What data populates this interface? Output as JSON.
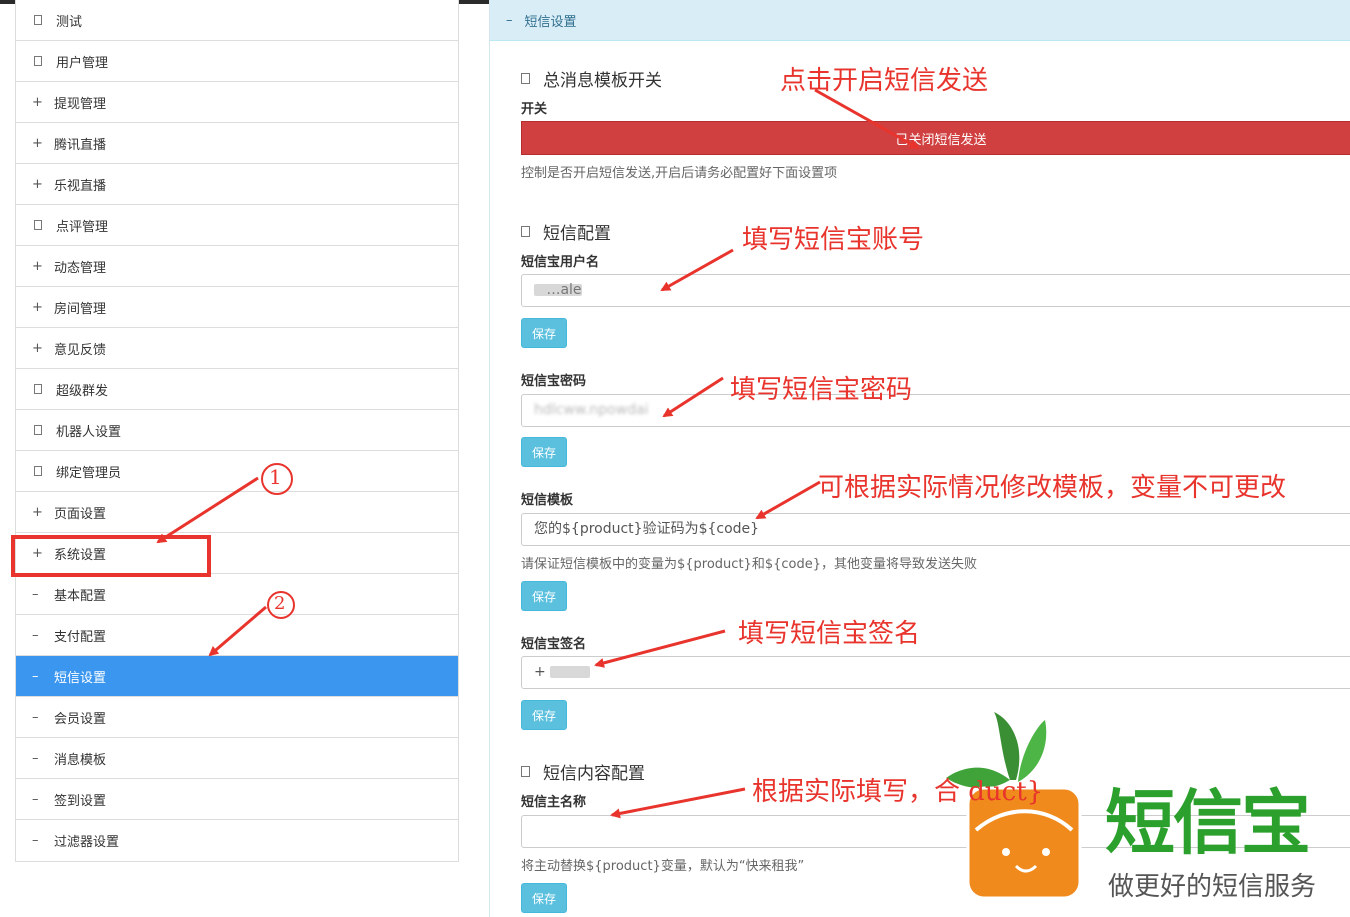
{
  "sidebar": {
    "items": [
      {
        "mark": "box",
        "label": "测试"
      },
      {
        "mark": "box",
        "label": "用户管理"
      },
      {
        "mark": "+",
        "label": "提现管理"
      },
      {
        "mark": "+",
        "label": "腾讯直播"
      },
      {
        "mark": "+",
        "label": "乐视直播"
      },
      {
        "mark": "box",
        "label": "点评管理"
      },
      {
        "mark": "+",
        "label": "动态管理"
      },
      {
        "mark": "+",
        "label": "房间管理"
      },
      {
        "mark": "+",
        "label": "意见反馈"
      },
      {
        "mark": "box",
        "label": "超级群发"
      },
      {
        "mark": "box",
        "label": "机器人设置"
      },
      {
        "mark": "box",
        "label": "绑定管理员"
      },
      {
        "mark": "+",
        "label": "页面设置"
      },
      {
        "mark": "+",
        "label": "系统设置"
      },
      {
        "mark": "–",
        "label": "基本配置"
      },
      {
        "mark": "–",
        "label": "支付配置"
      },
      {
        "mark": "–",
        "label": "短信设置",
        "active": true
      },
      {
        "mark": "–",
        "label": "会员设置"
      },
      {
        "mark": "–",
        "label": "消息模板"
      },
      {
        "mark": "–",
        "label": "签到设置"
      },
      {
        "mark": "–",
        "label": "过滤器设置"
      }
    ]
  },
  "panel": {
    "header_dash": "–",
    "header_title": "短信设置",
    "master_switch": {
      "title": "总消息模板开关",
      "switch_label": "开关",
      "button_text": "已关闭短信发送",
      "hint": "控制是否开启短信发送,开启后请务必配置好下面设置项"
    },
    "sms_config": {
      "title": "短信配置",
      "username_label": "短信宝用户名",
      "username_value": "…ale",
      "password_label": "短信宝密码",
      "password_value": "hdlcww.npowdai",
      "template_label": "短信模板",
      "template_value": "您的${product}验证码为${code}",
      "template_hint": "请保证短信模板中的变量为${product}和${code}，其他变量将导致发送失败",
      "signature_label": "短信宝签名",
      "signature_value": "+"
    },
    "content_config": {
      "title": "短信内容配置",
      "subject_label": "短信主名称",
      "subject_value": "",
      "subject_hint": "将主动替换${product}变量，默认为“快来租我”"
    },
    "save_label": "保存"
  },
  "annotations": {
    "a1": "点击开启短信发送",
    "a2": "填写短信宝账号",
    "a3": "填写短信宝密码",
    "a4": "可根据实际情况修改模板，变量不可更改",
    "a5": "填写短信宝签名",
    "a6": "根据实际填写，合   duct}",
    "circle1": "1",
    "circle2": "2"
  },
  "logo": {
    "name": "短信宝",
    "slogan": "做更好的短信服务",
    "colors": {
      "green": "#2ca02c",
      "orange": "#f08a1c",
      "leaf": "#3fa33a"
    }
  },
  "colors": {
    "active_item": "#3a96ef",
    "toggle_off": "#d14040",
    "save_button": "#5bc0de",
    "panel_header": "#d9edf7",
    "annotation": "#e8342c"
  }
}
